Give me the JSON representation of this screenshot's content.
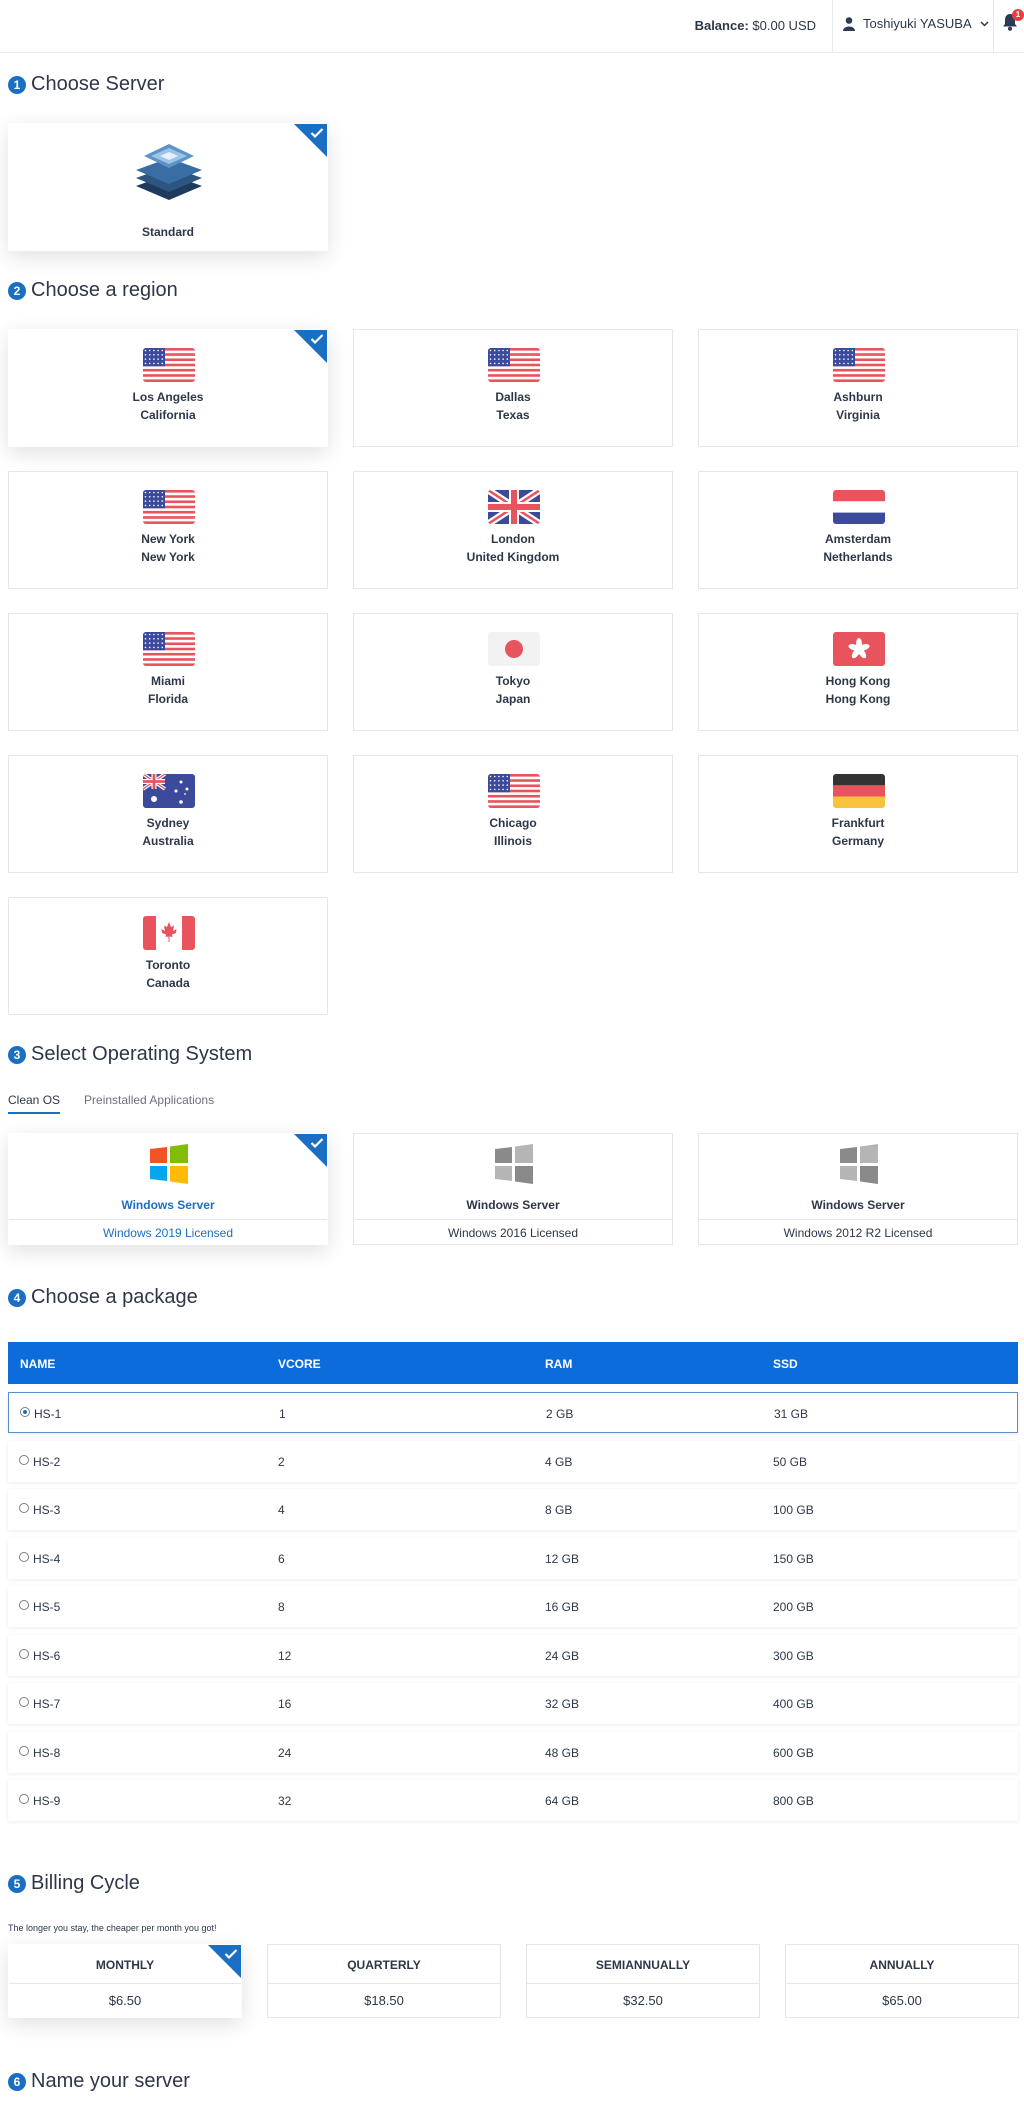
{
  "header": {
    "balance_label": "Balance:",
    "balance_value": "$0.00 USD",
    "user_name": "Toshiyuki YASUBA",
    "notification_count": "1"
  },
  "sections": {
    "server": {
      "num": "1",
      "title": "Choose Server"
    },
    "region": {
      "num": "2",
      "title": "Choose a region"
    },
    "os": {
      "num": "3",
      "title": "Select Operating System"
    },
    "package": {
      "num": "4",
      "title": "Choose a package"
    },
    "billing": {
      "num": "5",
      "title": "Billing Cycle"
    },
    "name": {
      "num": "6",
      "title": "Name your server"
    }
  },
  "server": {
    "label": "Standard",
    "selected": true
  },
  "regions": [
    {
      "city": "Los Angeles",
      "sub": "California",
      "flag": "us-flag",
      "selected": true
    },
    {
      "city": "Dallas",
      "sub": "Texas",
      "flag": "us-flag"
    },
    {
      "city": "Ashburn",
      "sub": "Virginia",
      "flag": "us-flag"
    },
    {
      "city": "New York",
      "sub": "New York",
      "flag": "us-flag"
    },
    {
      "city": "London",
      "sub": "United Kingdom",
      "flag": "uk-flag"
    },
    {
      "city": "Amsterdam",
      "sub": "Netherlands",
      "flag": "nl-flag"
    },
    {
      "city": "Miami",
      "sub": "Florida",
      "flag": "us-flag"
    },
    {
      "city": "Tokyo",
      "sub": "Japan",
      "flag": "jp-flag"
    },
    {
      "city": "Hong Kong",
      "sub": "Hong Kong",
      "flag": "hk-flag"
    },
    {
      "city": "Sydney",
      "sub": "Australia",
      "flag": "au-flag"
    },
    {
      "city": "Chicago",
      "sub": "Illinois",
      "flag": "us-flag"
    },
    {
      "city": "Frankfurt",
      "sub": "Germany",
      "flag": "de-flag"
    },
    {
      "city": "Toronto",
      "sub": "Canada",
      "flag": "ca-flag"
    }
  ],
  "os_tabs": [
    {
      "label": "Clean OS",
      "active": true
    },
    {
      "label": "Preinstalled Applications",
      "active": false
    }
  ],
  "os_options": [
    {
      "name": "Windows Server",
      "version": "Windows 2019 Licensed",
      "icon": "windows-color-icon",
      "selected": true
    },
    {
      "name": "Windows Server",
      "version": "Windows 2016 Licensed",
      "icon": "windows-gray-icon"
    },
    {
      "name": "Windows Server",
      "version": "Windows 2012 R2 Licensed",
      "icon": "windows-gray-icon"
    }
  ],
  "package_table": {
    "headers": [
      "NAME",
      "VCORE",
      "RAM",
      "SSD"
    ],
    "rows": [
      {
        "name": "HS-1",
        "vcore": "1",
        "ram": "2 GB",
        "ssd": "31 GB",
        "selected": true
      },
      {
        "name": "HS-2",
        "vcore": "2",
        "ram": "4 GB",
        "ssd": "50 GB"
      },
      {
        "name": "HS-3",
        "vcore": "4",
        "ram": "8 GB",
        "ssd": "100 GB"
      },
      {
        "name": "HS-4",
        "vcore": "6",
        "ram": "12 GB",
        "ssd": "150 GB"
      },
      {
        "name": "HS-5",
        "vcore": "8",
        "ram": "16 GB",
        "ssd": "200 GB"
      },
      {
        "name": "HS-6",
        "vcore": "12",
        "ram": "24 GB",
        "ssd": "300 GB"
      },
      {
        "name": "HS-7",
        "vcore": "16",
        "ram": "32 GB",
        "ssd": "400 GB"
      },
      {
        "name": "HS-8",
        "vcore": "24",
        "ram": "48 GB",
        "ssd": "600 GB"
      },
      {
        "name": "HS-9",
        "vcore": "32",
        "ram": "64 GB",
        "ssd": "800 GB"
      }
    ]
  },
  "billing": {
    "note": "The longer you stay, the cheaper per month you got!",
    "options": [
      {
        "name": "MONTHLY",
        "price": "$6.50",
        "selected": true
      },
      {
        "name": "QUARTERLY",
        "price": "$18.50"
      },
      {
        "name": "SEMIANNUALLY",
        "price": "$32.50"
      },
      {
        "name": "ANNUALLY",
        "price": "$65.00"
      }
    ]
  },
  "colors": {
    "accent": "#1b6fc2",
    "table_header": "#0c6cdc",
    "badge": "#e53e3e"
  }
}
